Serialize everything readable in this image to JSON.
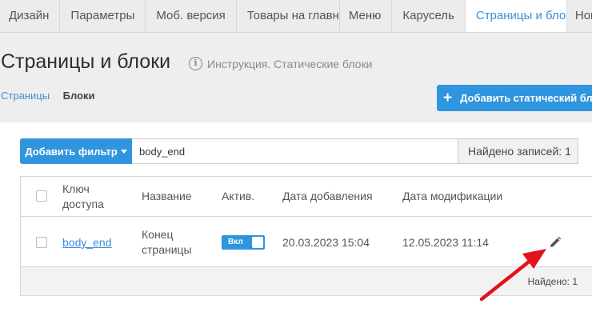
{
  "tabs": [
    {
      "label": "Дизайн"
    },
    {
      "label": "Параметры"
    },
    {
      "label": "Моб. версия"
    },
    {
      "label": "Товары на главной"
    },
    {
      "label": "Меню"
    },
    {
      "label": "Карусель"
    },
    {
      "label": "Страницы и блоки"
    },
    {
      "label": "Новости"
    }
  ],
  "active_tab_index": 6,
  "page_title": "Страницы и блоки",
  "instruction": {
    "icon": "info-icon",
    "text": "Инструкция. Статические блоки"
  },
  "subnav": {
    "pages_link": "Страницы",
    "blocks_current": "Блоки"
  },
  "add_static_block_button": {
    "icon": "plus-icon",
    "label": "Добавить статический блок"
  },
  "filter": {
    "button_label": "Добавить фильтр",
    "input_value": "body_end",
    "found_text": "Найдено записей: 1"
  },
  "table": {
    "headers": {
      "key": "Ключ доступа",
      "name": "Название",
      "active": "Актив.",
      "date_added": "Дата добавления",
      "date_modified": "Дата модификации"
    },
    "rows": [
      {
        "key": "body_end",
        "name": "Конец страницы",
        "active_label": "Вкл",
        "active": true,
        "date_added": "20.03.2023 15:04",
        "date_modified": "12.05.2023 11:14"
      }
    ]
  },
  "footer": {
    "found_text": "Найдено: 1"
  },
  "colors": {
    "accent": "#2f95df",
    "arrow": "#e0141a"
  }
}
